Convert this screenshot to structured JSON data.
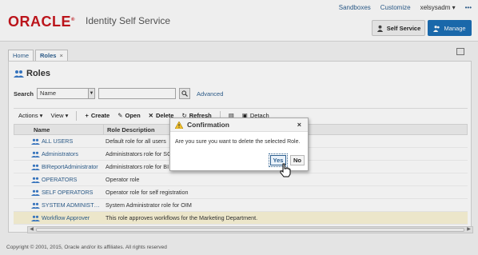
{
  "header": {
    "brand": "ORACLE",
    "app_title": "Identity Self Service",
    "topnav": {
      "sandboxes": "Sandboxes",
      "customize": "Customize",
      "user": "xelsysadm ▾"
    },
    "self_service_label": "Self Service",
    "manage_label": "Manage"
  },
  "tabs": [
    {
      "label": "Home"
    },
    {
      "label": "Roles",
      "close": "×"
    }
  ],
  "page": {
    "title": "Roles",
    "search_label": "Search",
    "search_field_value": "Name",
    "advanced_link": "Advanced"
  },
  "toolbar": {
    "actions": "Actions ▾",
    "view": "View ▾",
    "create": "Create",
    "open": "Open",
    "delete": "Delete",
    "refresh": "Refresh",
    "detach": "Detach"
  },
  "table": {
    "columns": [
      "Name",
      "Role Description"
    ],
    "rows": [
      {
        "name": "ALL USERS",
        "desc": "Default role for all users"
      },
      {
        "name": "Administrators",
        "desc": "Administrators role for SOA"
      },
      {
        "name": "BIReportAdministrator",
        "desc": "Administrators role for BI Pu"
      },
      {
        "name": "OPERATORS",
        "desc": "Operator role"
      },
      {
        "name": "SELF OPERATORS",
        "desc": "Operator role for self registration"
      },
      {
        "name": "SYSTEM ADMINIST…",
        "desc": "System Administrator role for OIM"
      },
      {
        "name": "Workflow Approver",
        "desc": "This role approves workflows for the Marketing Department."
      }
    ]
  },
  "dialog": {
    "title": "Confirmation",
    "close": "×",
    "message": "Are you sure you want to delete the selected Role.",
    "yes": "Yes",
    "no": "No"
  },
  "footer": {
    "copyright": "Copyright © 2001, 2015, Oracle and/or its affiliates. All rights reserved"
  },
  "colors": {
    "brand_red": "#c7161d",
    "link_blue": "#2d5f8f",
    "manage_blue": "#1c6fb5",
    "selected_row": "#fbf5d7"
  }
}
